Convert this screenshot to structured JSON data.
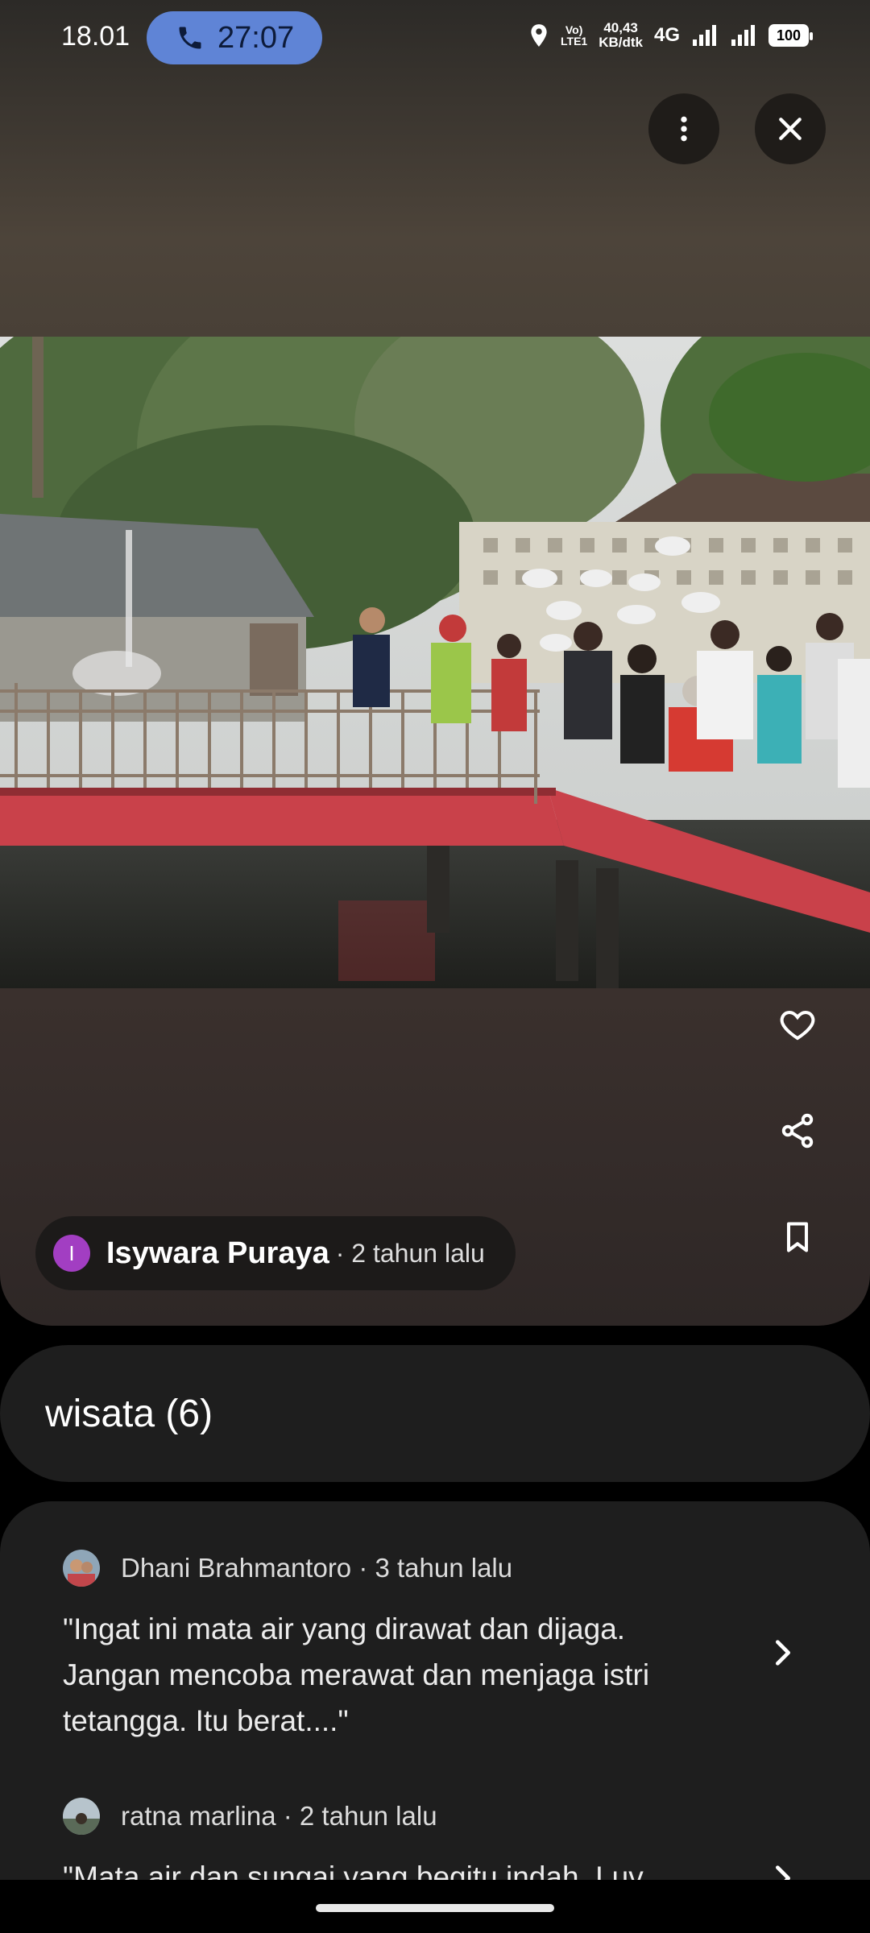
{
  "status_bar": {
    "time": "18.01",
    "call_timer": "27:07",
    "volte_top": "Vo)",
    "volte_bottom": "LTE1",
    "speed_top": "40,43",
    "speed_bottom": "KB/dtk",
    "network": "4G",
    "battery": "100"
  },
  "icons": {
    "phone": "phone-icon",
    "location": "location-pin-icon",
    "more": "more-vert-icon",
    "close": "close-icon",
    "like": "heart-icon",
    "share": "share-icon",
    "save": "bookmark-icon",
    "chevron": "chevron-right-icon"
  },
  "photo_post": {
    "author_initial": "I",
    "author_name": "Isywara Puraya",
    "posted": "· 2 tahun lalu"
  },
  "album": {
    "label": "wisata (6)"
  },
  "reviews": [
    {
      "author": "Dhani Brahmantoro · 3 tahun lalu",
      "text": "\"Ingat ini mata air yang dirawat dan dijaga. Jangan mencoba merawat dan menjaga istri tetangga. Itu berat....\""
    },
    {
      "author": "ratna marlina · 2 tahun lalu",
      "text": "\"Mata air dan sungai yang begitu indah. Luv"
    }
  ],
  "colors": {
    "call_pill": "#5f84d6",
    "author_avatar": "#a23ec2",
    "bridge_red": "#c9414a",
    "card_bg": "#1e1e1e"
  }
}
